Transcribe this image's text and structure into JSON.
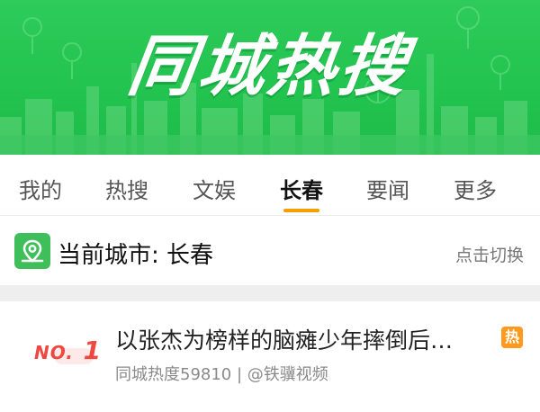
{
  "banner": {
    "title": "同城热搜"
  },
  "tabs": [
    {
      "label": "我的"
    },
    {
      "label": "热搜"
    },
    {
      "label": "文娱"
    },
    {
      "label": "长春"
    },
    {
      "label": "要闻"
    },
    {
      "label": "更多"
    }
  ],
  "city": {
    "label": "当前城市: 长春",
    "switch_label": "点击切换"
  },
  "list": [
    {
      "rank_prefix": "NO.",
      "rank_number": "1",
      "title": "以张杰为榜样的脑瘫少年摔倒后…",
      "meta": "同城热度59810 | @铁骥视频",
      "badge": "热"
    }
  ],
  "colors": {
    "banner_green": "#22c34f",
    "accent_orange": "#f5a000",
    "rank_red": "#f0473f",
    "hot_badge": "#ff9a1f"
  }
}
